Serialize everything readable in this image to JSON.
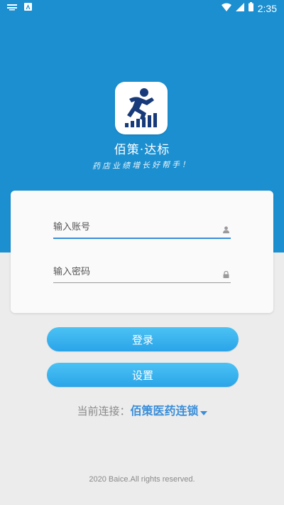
{
  "status_bar": {
    "time": "2:35"
  },
  "brand": {
    "app_name": "佰策·达标",
    "slogan": "药店业绩增长好帮手！",
    "logo_icon": "runner-bar-chart-logo",
    "hero_color": "#1b8fd0"
  },
  "login": {
    "account_placeholder": "输入账号",
    "password_placeholder": "输入密码",
    "login_label": "登录",
    "settings_label": "设置",
    "button_color": "#2aa4e8"
  },
  "connection": {
    "label": "当前连接：",
    "value": "佰策医药连锁"
  },
  "footer": {
    "copyright": "2020 Baice.All rights reserved."
  }
}
